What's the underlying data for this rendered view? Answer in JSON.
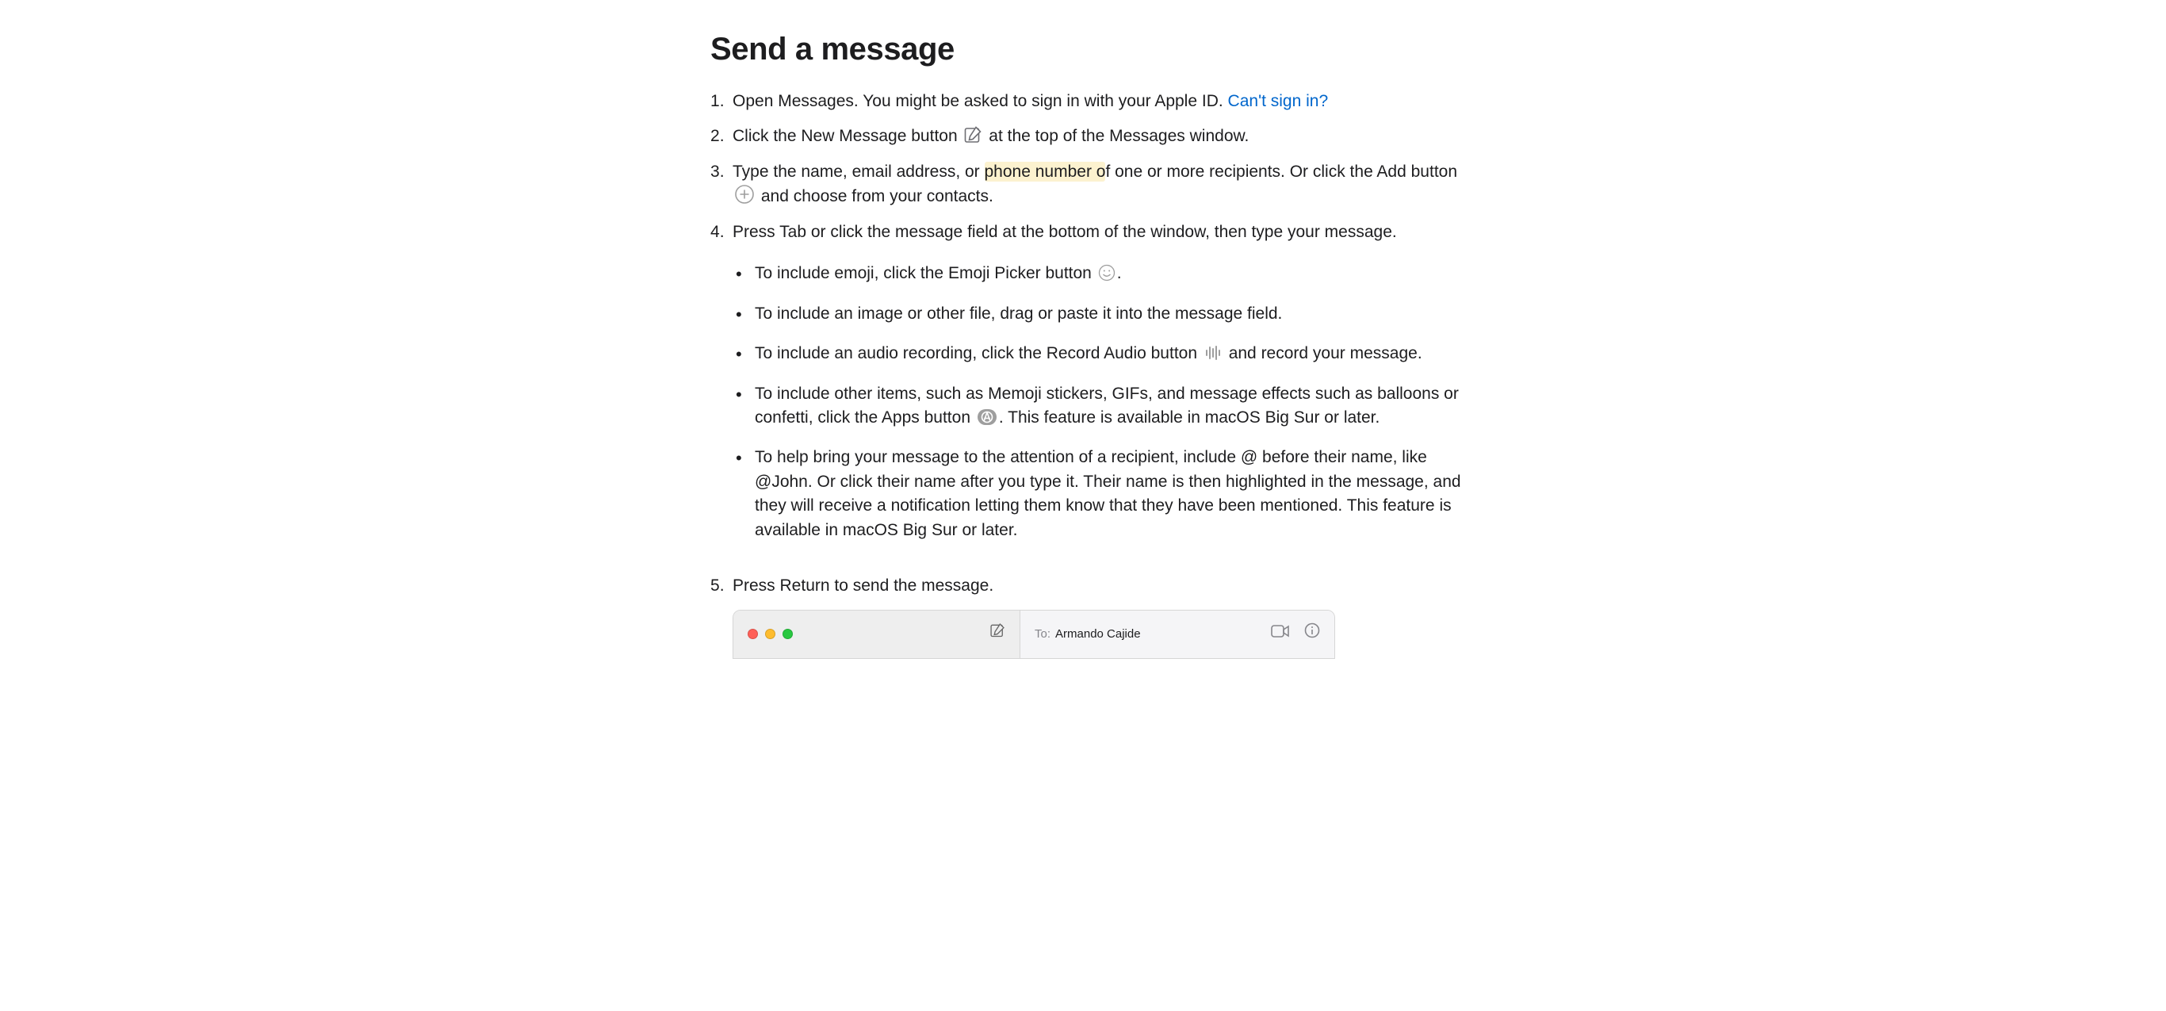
{
  "heading": "Send a message",
  "steps": {
    "s1": {
      "text_before_link": "Open Messages. You might be asked to sign in with your Apple ID. ",
      "link_text": "Can't sign in?"
    },
    "s2": {
      "part1": "Click the New Message button ",
      "part2": " at the top of the Messages window."
    },
    "s3": {
      "part1": "Type the name, email address, or ",
      "highlight": "phone number o",
      "part2": "f one or more recipients. Or click the Add button ",
      "part3": " and choose from your contacts."
    },
    "s4": {
      "text": "Press Tab or click the message field at the bottom of the window, then type your message.",
      "bullets": {
        "b1": {
          "part1": "To include emoji, click the Emoji Picker button ",
          "part2": "."
        },
        "b2": {
          "text": "To include an image or other file, drag or paste it into the message field."
        },
        "b3": {
          "part1": "To include an audio recording, click the Record Audio button ",
          "part2": " and record your message."
        },
        "b4": {
          "part1": "To include other items, such as Memoji stickers, GIFs, and message effects such as balloons or confetti, click the Apps button ",
          "part2": ". This feature is available in macOS Big Sur or later."
        },
        "b5": {
          "text": "To help bring your message to the attention of a recipient, include @ before their name, like @John. Or click their name after you type it. Their name is then highlighted in the message, and they will receive a notification letting them know that they have been mentioned. This feature is available in macOS Big Sur or later."
        }
      }
    },
    "s5": {
      "text": "Press Return to send the message."
    }
  },
  "app": {
    "to_label": "To:",
    "to_name": "Armando Cajide"
  }
}
